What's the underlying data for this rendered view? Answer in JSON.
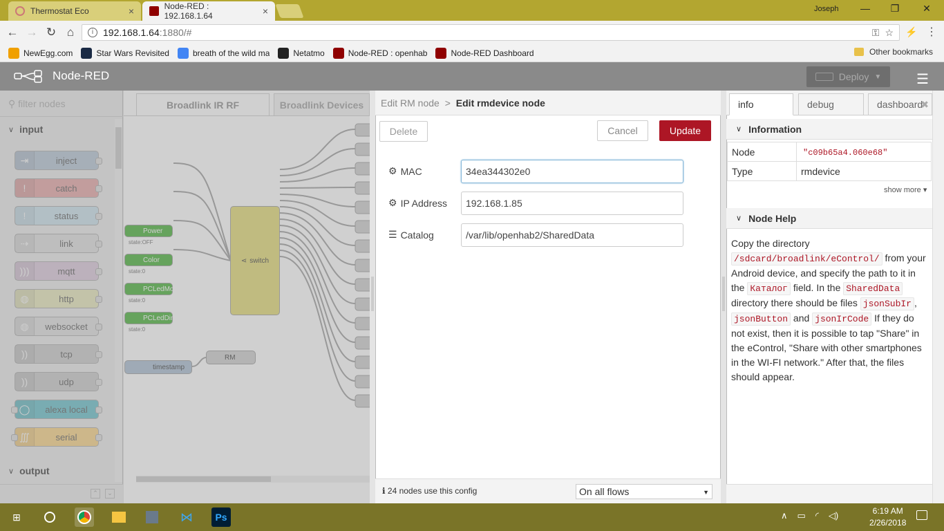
{
  "browser": {
    "tabs": [
      {
        "title": "Thermostat Eco",
        "close": "×",
        "active": false
      },
      {
        "title": "Node-RED : 192.168.1.64",
        "close": "×",
        "active": true
      }
    ],
    "user": "Joseph",
    "window_controls": {
      "minimize": "—",
      "maximize": "❐",
      "close": "✕"
    },
    "url_host": "192.168.1.64",
    "url_rest": ":1880/#",
    "bookmarks": [
      {
        "label": "NewEgg.com",
        "color": "#f0a000"
      },
      {
        "label": "Star Wars Revisited",
        "color": "#1a2a44"
      },
      {
        "label": "breath of the wild ma",
        "color": "#4285f4"
      },
      {
        "label": "Netatmo",
        "color": "#222222"
      },
      {
        "label": "Node-RED : openhab",
        "color": "#8f0000"
      },
      {
        "label": "Node-RED Dashboard",
        "color": "#8f0000"
      }
    ],
    "other_bookmarks": "Other bookmarks"
  },
  "nodered": {
    "app_title": "Node-RED",
    "deploy_label": "Deploy",
    "filter_placeholder": "filter nodes",
    "palette": {
      "input_category": "input",
      "output_category": "output",
      "nodes": [
        {
          "label": "inject",
          "color": "#a6bbcf",
          "icon": "⇥"
        },
        {
          "label": "catch",
          "color": "#e49191",
          "icon": "!"
        },
        {
          "label": "status",
          "color": "#c0deed",
          "icon": "!"
        },
        {
          "label": "link",
          "color": "#dddddd",
          "icon": "⇢"
        },
        {
          "label": "mqtt",
          "color": "#d8bfd8",
          "icon": ")))"
        },
        {
          "label": "http",
          "color": "#e7e7ae",
          "icon": "◍"
        },
        {
          "label": "websocket",
          "color": "#dddddd",
          "icon": "◍"
        },
        {
          "label": "tcp",
          "color": "#c0c0c0",
          "icon": "))"
        },
        {
          "label": "udp",
          "color": "#c0c0c0",
          "icon": "))"
        },
        {
          "label": "alexa local",
          "color": "#40b4c2",
          "icon": "◯"
        },
        {
          "label": "serial",
          "color": "#ffcc66",
          "icon": "∭"
        }
      ]
    },
    "workspace_tabs": [
      "Broadlink IR RF",
      "Broadlink Devices"
    ],
    "flow_nodes": [
      {
        "label": "Power",
        "status": "state:OFF"
      },
      {
        "label": "Color",
        "status": "state:0"
      },
      {
        "label": "PCLedMode",
        "status": "state:0"
      },
      {
        "label": "PCLedDimmerNR",
        "status": "state:0"
      }
    ],
    "switch_label": "switch",
    "timestamp_label": "timestamp",
    "rm_label": "RM"
  },
  "editor": {
    "breadcrumb_parent": "Edit RM node",
    "breadcrumb_sep": ">",
    "breadcrumb_current": "Edit rmdevice node",
    "delete_label": "Delete",
    "cancel_label": "Cancel",
    "update_label": "Update",
    "fields": {
      "mac_label": "MAC",
      "mac_value": "34ea344302e0",
      "ip_label": "IP Address",
      "ip_value": "192.168.1.85",
      "catalog_label": "Catalog",
      "catalog_value": "/var/lib/openhab2/SharedData"
    },
    "footer_usage": "24 nodes use this config",
    "footer_scope": "On all flows"
  },
  "sidebar": {
    "tabs": [
      "info",
      "debug",
      "dashboard"
    ],
    "information_title": "Information",
    "node_label": "Node",
    "node_value": "\"c09b65a4.060e68\"",
    "type_label": "Type",
    "type_value": "rmdevice",
    "show_more": "show more ▾",
    "help_title": "Node Help",
    "help": {
      "t1": "Copy the directory",
      "c1": "/sdcard/broadlink/eControl/",
      "t2": "from your Android device, and specify the path to it in the",
      "c2": "Каталог",
      "t3": "field. In the",
      "c3": "SharedData",
      "t4": "directory there should be files",
      "c4": "jsonSubIr",
      "t5": ",",
      "c5": "jsonButton",
      "t6": "and",
      "c6": "jsonIrCode",
      "t7": "If they do not exist, then it is possible to tap \"Share\" in the eControl, \"Share with other smartphones in the WI-FI network.\" After that, the files should appear."
    }
  },
  "taskbar": {
    "time": "6:19 AM",
    "date": "2/26/2018"
  }
}
